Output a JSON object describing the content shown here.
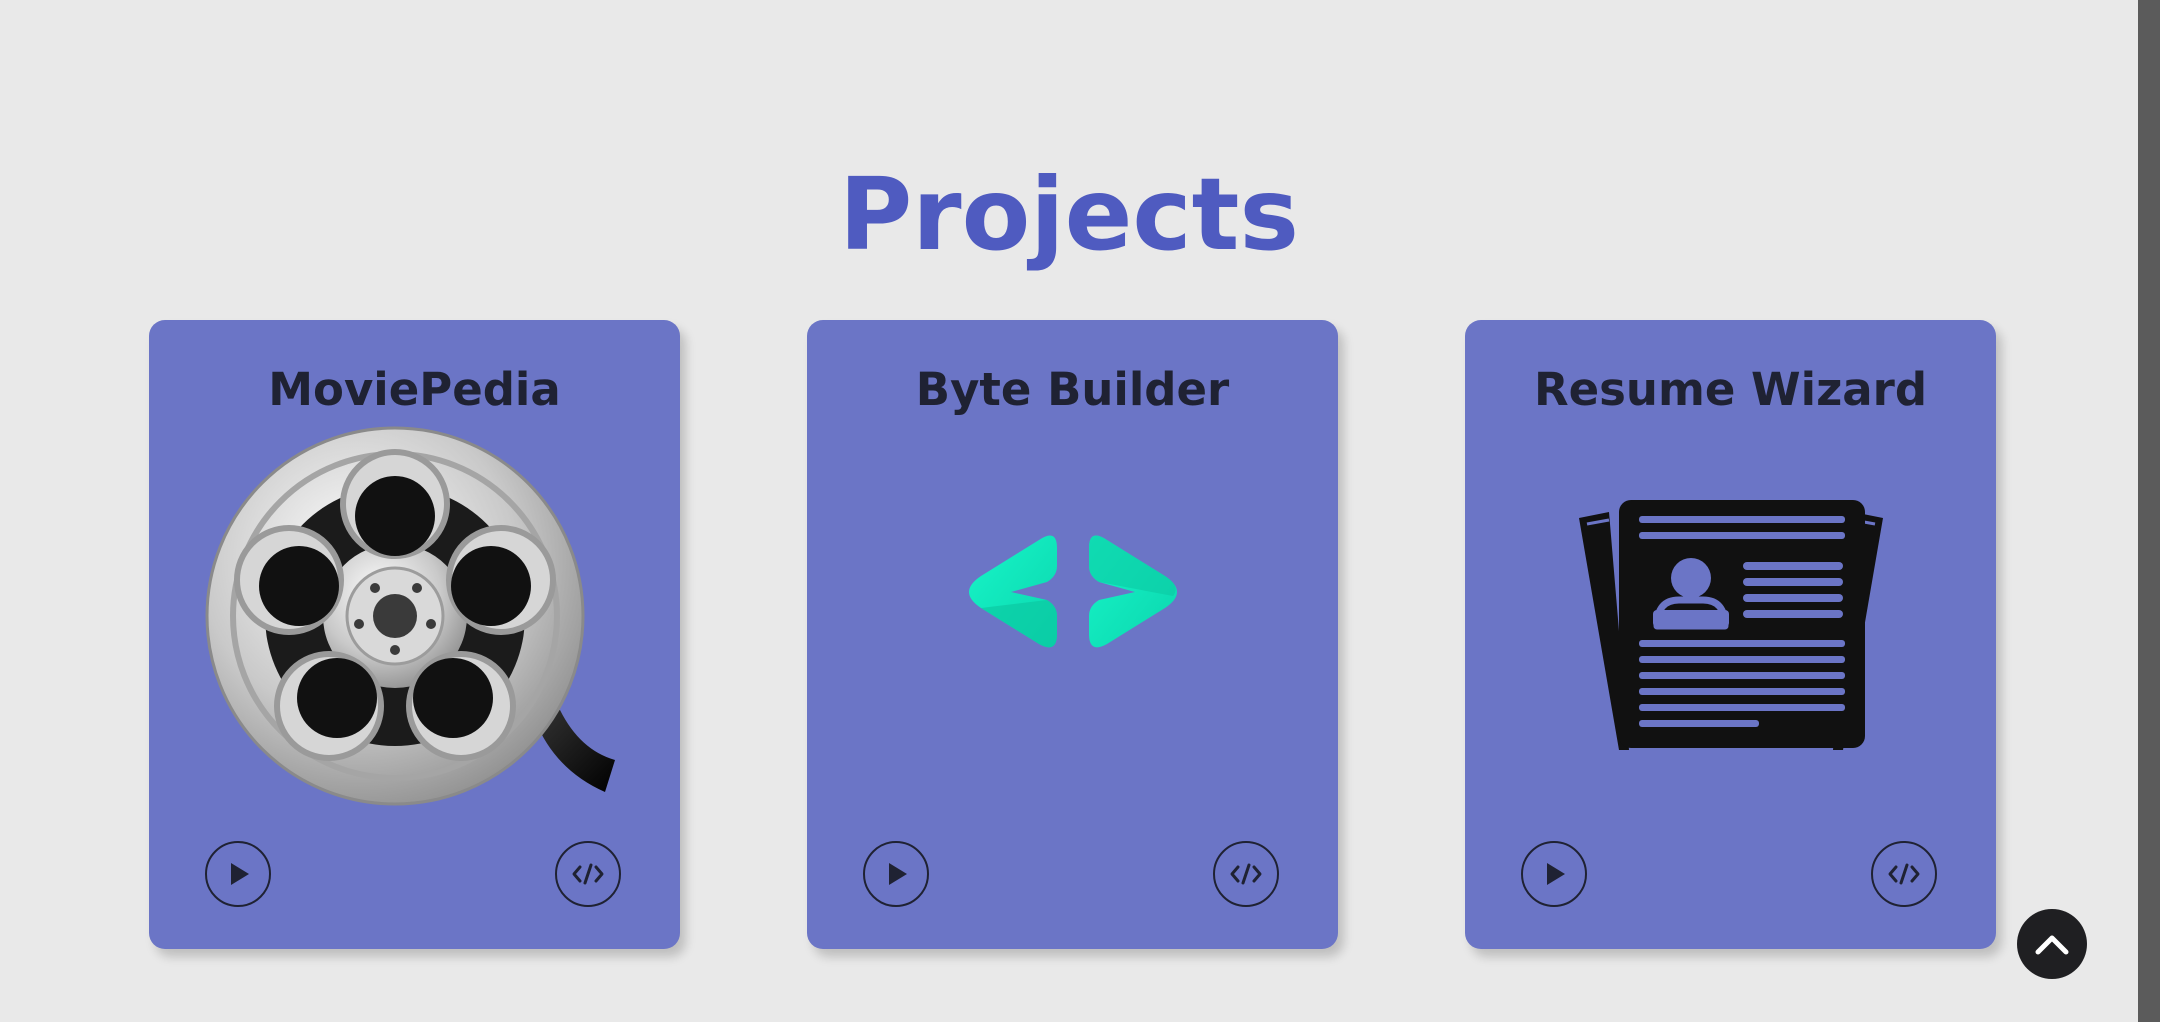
{
  "page": {
    "title": "Projects"
  },
  "projects": [
    {
      "title": "MoviePedia",
      "image_icon": "film-reel-icon",
      "play_icon": "play-icon",
      "code_icon": "code-icon"
    },
    {
      "title": "Byte Builder",
      "image_icon": "code-brackets-logo-icon",
      "play_icon": "play-icon",
      "code_icon": "code-icon"
    },
    {
      "title": "Resume Wizard",
      "image_icon": "resume-document-icon",
      "play_icon": "play-icon",
      "code_icon": "code-icon"
    }
  ],
  "scroll_top": {
    "icon": "chevron-up-icon"
  },
  "colors": {
    "background": "#e9e9e9",
    "title": "#4f5bc0",
    "card": "#6b75c6",
    "card_text": "#1f2233",
    "byte_builder_accent": "#17f5c8",
    "scroll_button": "#1f1f22"
  }
}
